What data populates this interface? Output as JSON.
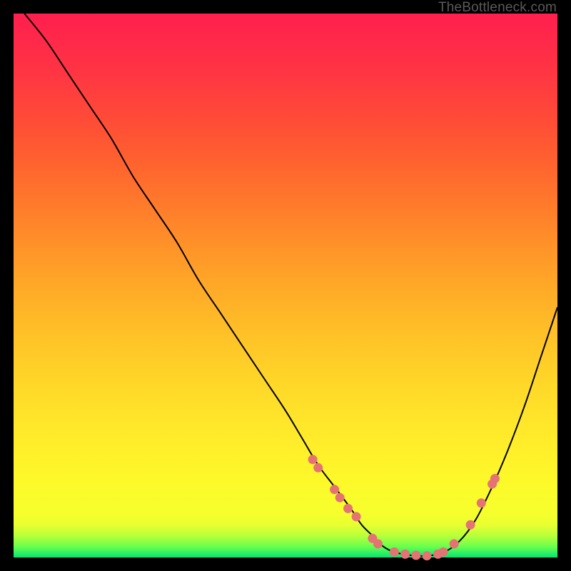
{
  "watermark": "TheBottleneck.com",
  "colors": {
    "background": "#000000",
    "curve": "#000000",
    "marker": "#e57373",
    "gradient_top": "#ff1f4e",
    "gradient_mid": "#fff22a",
    "gradient_bottom": "#00e676"
  },
  "chart_data": {
    "type": "line",
    "title": "",
    "xlabel": "",
    "ylabel": "",
    "xlim": [
      0,
      100
    ],
    "ylim": [
      0,
      100
    ],
    "grid": false,
    "series": [
      {
        "name": "bottleneck-curve",
        "x": [
          2,
          6,
          10,
          14,
          18,
          22,
          26,
          30,
          34,
          38,
          42,
          46,
          50,
          53,
          56,
          59,
          62,
          64,
          66,
          68,
          70,
          73,
          76,
          79,
          82,
          85,
          88,
          91,
          94,
          97,
          100
        ],
        "y": [
          100,
          95,
          89,
          83,
          77,
          70,
          64,
          58,
          51,
          45,
          39,
          33,
          27,
          22,
          17,
          13,
          9,
          6,
          4,
          2,
          1,
          0.4,
          0.3,
          0.9,
          3,
          7,
          13,
          20,
          28,
          37,
          46
        ]
      }
    ],
    "markers": [
      {
        "x": 55,
        "y": 18
      },
      {
        "x": 56,
        "y": 16.5
      },
      {
        "x": 59,
        "y": 12.5
      },
      {
        "x": 60,
        "y": 11
      },
      {
        "x": 61.5,
        "y": 9
      },
      {
        "x": 63,
        "y": 7.5
      },
      {
        "x": 66,
        "y": 3.5
      },
      {
        "x": 67,
        "y": 2.5
      },
      {
        "x": 70,
        "y": 1
      },
      {
        "x": 72,
        "y": 0.6
      },
      {
        "x": 74,
        "y": 0.4
      },
      {
        "x": 76,
        "y": 0.3
      },
      {
        "x": 78,
        "y": 0.6
      },
      {
        "x": 79,
        "y": 1
      },
      {
        "x": 81,
        "y": 2.5
      },
      {
        "x": 84,
        "y": 6
      },
      {
        "x": 86,
        "y": 10
      },
      {
        "x": 88,
        "y": 13.5
      },
      {
        "x": 88.5,
        "y": 14.5
      }
    ]
  }
}
